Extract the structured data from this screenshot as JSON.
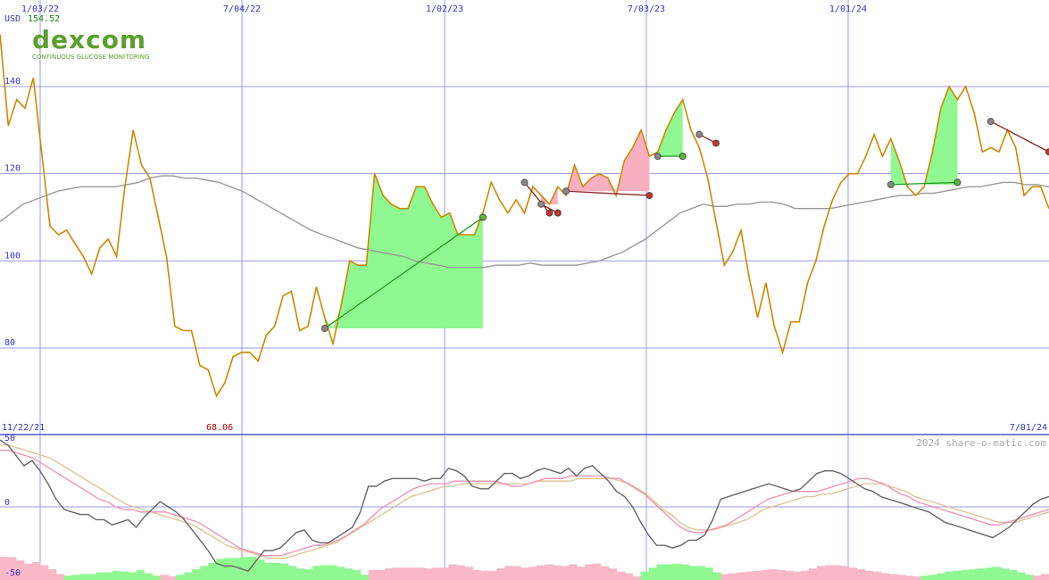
{
  "logo": {
    "name": "dexcom",
    "tagline": "CONTINUOUS GLUCOSE MONITORING"
  },
  "header": {
    "currency": "USD",
    "last_price": "154.52",
    "min_price_label": "68.06"
  },
  "credit": "2024 share-o-matic.com",
  "colors": {
    "price_line": "#cc8800",
    "ma_line": "#999999",
    "grid": "#9999ee",
    "gain_fill": "#90f890",
    "loss_fill": "#f8b0c0",
    "osc_main": "#666666",
    "osc_fast": "#f090b0",
    "osc_slow": "#e0c090"
  },
  "chart_data": [
    {
      "type": "line",
      "x_ticks_top": [
        "1/03/22",
        "7/04/22",
        "1/02/23",
        "7/03/23",
        "1/01/24"
      ],
      "x_ticks_bottom": [
        "11/22/21",
        "7/01/24"
      ],
      "y_ticks": [
        "80",
        "100",
        "120",
        "140"
      ],
      "ylim": [
        70,
        150
      ],
      "series": [
        {
          "values": [
            152,
            131,
            137,
            135,
            142,
            125,
            108,
            106,
            107,
            104,
            101,
            97,
            103,
            105,
            101,
            117,
            130,
            122,
            119,
            110,
            101,
            85,
            84,
            84,
            76,
            75,
            69,
            72,
            78,
            79,
            79,
            77,
            83,
            85,
            92,
            93,
            84,
            85,
            94,
            87,
            81,
            90,
            100,
            99,
            99,
            120,
            115,
            113,
            112,
            112,
            117,
            117,
            113,
            110,
            111,
            106,
            106,
            106,
            111,
            118,
            114,
            111,
            114,
            111,
            117,
            115,
            113,
            117,
            115,
            122,
            117,
            119,
            120,
            119,
            115,
            123,
            126,
            130,
            124,
            125,
            130,
            134,
            137,
            130,
            126,
            119,
            109,
            99,
            102,
            107,
            96,
            87,
            95,
            85,
            79,
            86,
            86,
            95,
            100,
            108,
            114,
            118,
            120,
            120,
            124,
            129,
            124,
            128,
            123,
            117,
            115,
            117,
            125,
            135,
            140,
            137,
            140,
            134,
            125,
            126,
            125,
            130,
            126,
            115,
            117,
            117,
            112
          ]
        },
        {
          "values": [
            109,
            111,
            113,
            114,
            115,
            116,
            116.5,
            117,
            117,
            117,
            117,
            117.5,
            118,
            119,
            119.5,
            119.5,
            119,
            119,
            118.5,
            118,
            117,
            116,
            114.5,
            113,
            111.5,
            110,
            108.5,
            107,
            106,
            105,
            104,
            103,
            102.5,
            102,
            101.5,
            101,
            100,
            99.5,
            99,
            98.5,
            98.5,
            98.5,
            98.5,
            99,
            99,
            99,
            99.5,
            99,
            99,
            99,
            99,
            99.5,
            100,
            101,
            102,
            103.5,
            105,
            107,
            109,
            111,
            112,
            113,
            112.5,
            112.5,
            113,
            113,
            113.5,
            113.5,
            113,
            112,
            112,
            112,
            112,
            112.5,
            113,
            113.5,
            114,
            114.5,
            115,
            115,
            115.5,
            115.5,
            116,
            116.5,
            117,
            117,
            117.5,
            118,
            118,
            117.5,
            117.5,
            117
          ]
        }
      ],
      "trades": [
        {
          "entry": 84.5,
          "exit": 110
        },
        {
          "entry": 118,
          "exit": 111
        },
        {
          "entry": 113,
          "exit": 111
        },
        {
          "entry": 116,
          "exit": 115
        },
        {
          "entry": 124,
          "exit": 124
        },
        {
          "entry": 129,
          "exit": 127
        },
        {
          "entry": 117.5,
          "exit": 118
        },
        {
          "entry": 132,
          "exit": 125
        }
      ]
    },
    {
      "type": "line",
      "y_ticks": [
        "50",
        "0",
        "-50"
      ],
      "ylim": [
        -55,
        50
      ],
      "series": [
        {
          "values": [
            52,
            48,
            40,
            32,
            36,
            28,
            18,
            6,
            -2,
            -4,
            -6,
            -6,
            -10,
            -10,
            -14,
            -12,
            -10,
            -16,
            -8,
            -2,
            4,
            0,
            -4,
            -10,
            -18,
            -26,
            -34,
            -44,
            -46,
            -46,
            -48,
            -50,
            -42,
            -34,
            -34,
            -32,
            -26,
            -20,
            -18,
            -26,
            -28,
            -28,
            -24,
            -20,
            -16,
            -4,
            16,
            16,
            20,
            22,
            22,
            22,
            22,
            20,
            22,
            22,
            30,
            28,
            24,
            16,
            14,
            14,
            20,
            26,
            26,
            22,
            24,
            28,
            30,
            28,
            26,
            30,
            24,
            30,
            32,
            26,
            20,
            12,
            8,
            0,
            -12,
            -22,
            -30,
            -30,
            -32,
            -30,
            -26,
            -26,
            -22,
            -10,
            6,
            8,
            10,
            12,
            14,
            16,
            18,
            16,
            14,
            12,
            14,
            20,
            26,
            28,
            28,
            26,
            22,
            18,
            14,
            12,
            8,
            6,
            4,
            2,
            0,
            -2,
            -4,
            -8,
            -12,
            -14,
            -16,
            -18,
            -20,
            -22,
            -24,
            -20,
            -16,
            -10,
            -4,
            2,
            6,
            8
          ]
        },
        {
          "values": [
            44,
            44,
            42,
            40,
            38,
            34,
            30,
            26,
            22,
            18,
            14,
            10,
            6,
            4,
            0,
            -2,
            -2,
            -4,
            -4,
            -4,
            -4,
            -6,
            -8,
            -10,
            -12,
            -16,
            -20,
            -24,
            -28,
            -32,
            -34,
            -36,
            -38,
            -38,
            -38,
            -36,
            -34,
            -32,
            -30,
            -30,
            -28,
            -26,
            -22,
            -18,
            -14,
            -8,
            -2,
            2,
            6,
            10,
            14,
            16,
            18,
            18,
            18,
            20,
            20,
            20,
            20,
            20,
            20,
            18,
            16,
            16,
            18,
            20,
            22,
            22,
            22,
            24,
            24,
            24,
            24,
            24,
            22,
            22,
            18,
            14,
            10,
            4,
            -2,
            -8,
            -14,
            -18,
            -20,
            -20,
            -18,
            -16,
            -14,
            -10,
            -6,
            -2,
            2,
            6,
            8,
            10,
            12,
            12,
            12,
            12,
            14,
            16,
            18,
            20,
            22,
            22,
            20,
            18,
            14,
            10,
            8,
            4,
            2,
            0,
            -2,
            -4,
            -6,
            -8,
            -10,
            -12,
            -14,
            -14,
            -12,
            -10,
            -8,
            -6,
            -4,
            -2
          ]
        },
        {
          "values": [
            48,
            48,
            46,
            44,
            42,
            40,
            38,
            34,
            30,
            26,
            22,
            18,
            14,
            10,
            6,
            2,
            0,
            -2,
            -4,
            -6,
            -8,
            -10,
            -12,
            -14,
            -18,
            -22,
            -26,
            -30,
            -32,
            -34,
            -36,
            -38,
            -40,
            -40,
            -40,
            -38,
            -36,
            -34,
            -32,
            -30,
            -28,
            -24,
            -20,
            -16,
            -12,
            -8,
            -4,
            0,
            4,
            8,
            10,
            12,
            14,
            16,
            16,
            18,
            18,
            18,
            18,
            18,
            18,
            18,
            18,
            18,
            20,
            20,
            20,
            20,
            20,
            22,
            22,
            22,
            22,
            22,
            20,
            18,
            14,
            10,
            4,
            -2,
            -6,
            -12,
            -16,
            -18,
            -18,
            -18,
            -16,
            -14,
            -12,
            -10,
            -6,
            -2,
            0,
            2,
            4,
            6,
            8,
            8,
            10,
            10,
            12,
            14,
            16,
            18,
            18,
            18,
            16,
            14,
            12,
            8,
            6,
            4,
            2,
            0,
            -2,
            -4,
            -6,
            -8,
            -10,
            -12,
            -12,
            -12,
            -10,
            -8,
            -6,
            -4
          ]
        }
      ]
    }
  ]
}
